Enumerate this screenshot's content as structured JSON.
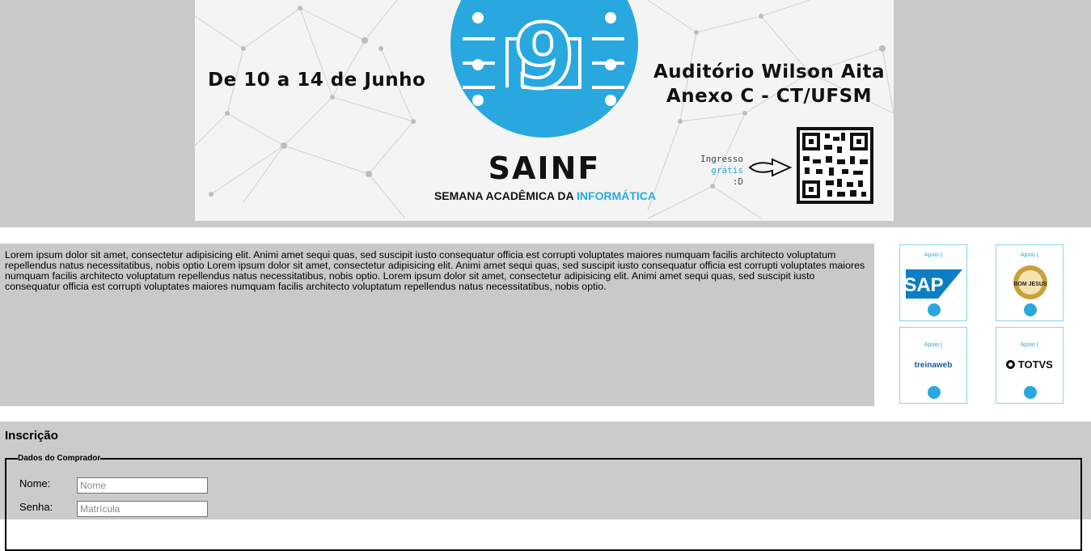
{
  "banner": {
    "edition_number": "9",
    "date_range": "De 10 a 14 de Junho",
    "venue_line1": "Auditório Wilson Aita",
    "venue_line2": "Anexo C - CT/UFSM",
    "event_name": "SAINF",
    "event_subtitle_prefix": "SEMANA ACADÊMICA DA",
    "event_subtitle_highlight": "INFORMÁTICA",
    "ticket_line1": "Ingresso",
    "ticket_line2_highlight": "grátis",
    "ticket_line2_suffix": ":D",
    "accent_color": "#29a8e0"
  },
  "about": {
    "text": "Lorem ipsum dolor sit amet, consectetur adipisicing elit. Animi amet sequi quas, sed suscipit iusto consequatur officia est corrupti voluptates maiores numquam facilis architecto voluptatum repellendus natus necessitatibus, nobis optio Lorem ipsum dolor sit amet, consectetur adipisicing elit. Animi amet sequi quas, sed suscipit iusto consequatur officia est corrupti voluptates maiores numquam facilis architecto voluptatum repellendus natus necessitatibus, nobis optio. Lorem ipsum dolor sit amet, consectetur adipisicing elit. Animi amet sequi quas, sed suscipit iusto consequatur officia est corrupti voluptates maiores numquam facilis architecto voluptatum repellendus natus necessitatibus, nobis optio."
  },
  "sponsors": {
    "apoio_label": "Apoio",
    "items": [
      {
        "name": "SAP"
      },
      {
        "name": "BOM JESUS"
      },
      {
        "name": "treinaweb"
      },
      {
        "name": "TOTVS"
      }
    ]
  },
  "registration": {
    "title": "Inscrição",
    "fieldset_legend": "Dados do Comprador",
    "name_label": "Nome:",
    "name_placeholder": "Nome",
    "password_label": "Senha:",
    "password_placeholder": "Matrícula"
  }
}
